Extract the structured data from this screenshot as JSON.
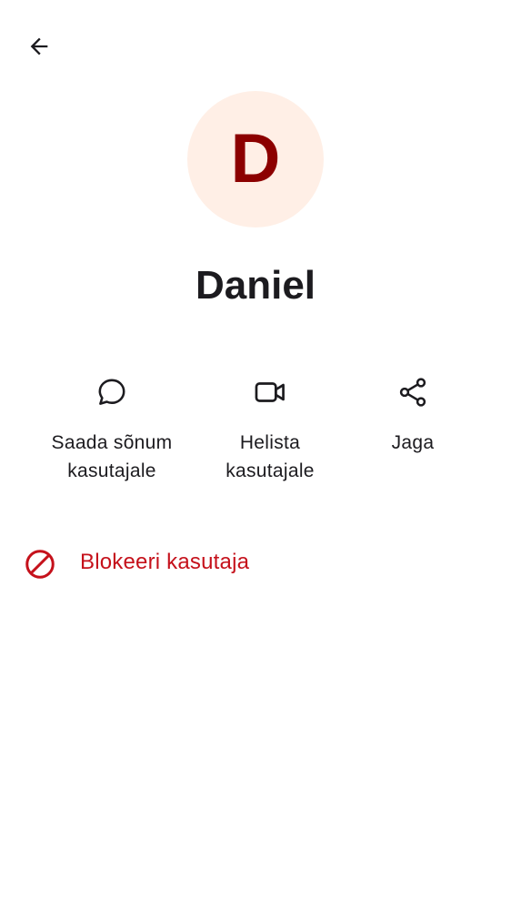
{
  "header": {
    "back_icon": "arrow-back-icon"
  },
  "profile": {
    "avatar_letter": "D",
    "avatar_bg": "#ffefe6",
    "avatar_fg": "#8c0000",
    "name": "Daniel"
  },
  "actions": [
    {
      "icon": "chat-bubble-icon",
      "label_line1": "Saada sõnum",
      "label_line2": "kasutajale"
    },
    {
      "icon": "video-camera-icon",
      "label_line1": "Helista",
      "label_line2": "kasutajale"
    },
    {
      "icon": "share-icon",
      "label_line1": "Jaga",
      "label_line2": ""
    }
  ],
  "block": {
    "icon": "block-icon",
    "label": "Blokeeri kasutaja",
    "color": "#c5111b"
  }
}
